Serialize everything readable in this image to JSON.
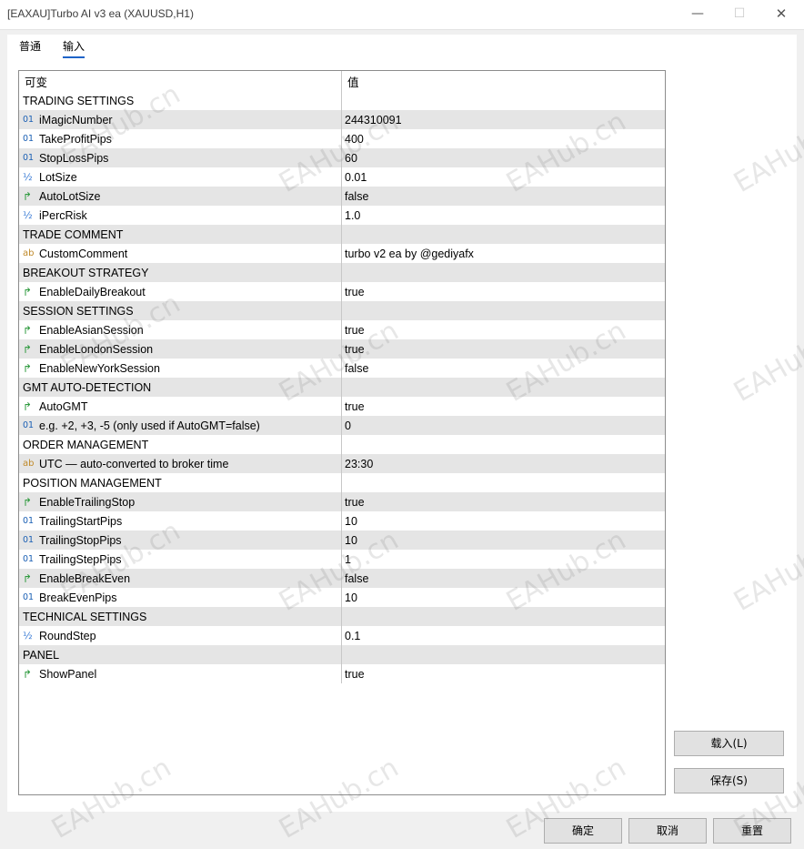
{
  "window": {
    "title": "[EAXAU]Turbo AI v3 ea (XAUUSD,H1)",
    "minimize": "—",
    "maximize": "☐",
    "close": "✕"
  },
  "tabs": [
    {
      "label": "普通"
    },
    {
      "label": "输入"
    }
  ],
  "grid": {
    "headers": {
      "variable": "可变",
      "value": "值"
    },
    "rows": [
      {
        "type": "section",
        "name": "TRADING SETTINGS",
        "value": ""
      },
      {
        "type": "int",
        "name": "iMagicNumber",
        "value": "244310091"
      },
      {
        "type": "int",
        "name": "TakeProfitPips",
        "value": "400"
      },
      {
        "type": "int",
        "name": "StopLossPips",
        "value": "60"
      },
      {
        "type": "double",
        "name": "LotSize",
        "value": "0.01"
      },
      {
        "type": "bool",
        "name": "AutoLotSize",
        "value": "false"
      },
      {
        "type": "double",
        "name": "iPercRisk",
        "value": "1.0"
      },
      {
        "type": "section",
        "name": "TRADE COMMENT",
        "value": ""
      },
      {
        "type": "string",
        "name": "CustomComment",
        "value": "turbo v2 ea by @gediyafx"
      },
      {
        "type": "section",
        "name": "BREAKOUT STRATEGY",
        "value": ""
      },
      {
        "type": "bool",
        "name": "EnableDailyBreakout",
        "value": "true"
      },
      {
        "type": "section",
        "name": "SESSION SETTINGS",
        "value": ""
      },
      {
        "type": "bool",
        "name": "EnableAsianSession",
        "value": "true"
      },
      {
        "type": "bool",
        "name": "EnableLondonSession",
        "value": "true"
      },
      {
        "type": "bool",
        "name": "EnableNewYorkSession",
        "value": "false"
      },
      {
        "type": "section",
        "name": "GMT AUTO-DETECTION",
        "value": ""
      },
      {
        "type": "bool",
        "name": "AutoGMT",
        "value": "true"
      },
      {
        "type": "int",
        "name": "e.g. +2, +3, -5 (only used if AutoGMT=false)",
        "value": "0"
      },
      {
        "type": "section",
        "name": "ORDER MANAGEMENT",
        "value": ""
      },
      {
        "type": "string",
        "name": "UTC — auto-converted to broker time",
        "value": "23:30"
      },
      {
        "type": "section",
        "name": "POSITION MANAGEMENT",
        "value": ""
      },
      {
        "type": "bool",
        "name": "EnableTrailingStop",
        "value": "true"
      },
      {
        "type": "int",
        "name": "TrailingStartPips",
        "value": "10"
      },
      {
        "type": "int",
        "name": "TrailingStopPips",
        "value": "10"
      },
      {
        "type": "int",
        "name": "TrailingStepPips",
        "value": "1"
      },
      {
        "type": "bool",
        "name": "EnableBreakEven",
        "value": "false"
      },
      {
        "type": "int",
        "name": "BreakEvenPips",
        "value": "10"
      },
      {
        "type": "section",
        "name": "TECHNICAL SETTINGS",
        "value": ""
      },
      {
        "type": "double",
        "name": "RoundStep",
        "value": "0.1"
      },
      {
        "type": "section",
        "name": "PANEL",
        "value": ""
      },
      {
        "type": "bool",
        "name": "ShowPanel",
        "value": "true"
      }
    ]
  },
  "icons": {
    "int": {
      "glyph": "01",
      "name": "integer-type-icon"
    },
    "double": {
      "glyph": "½",
      "name": "double-type-icon"
    },
    "bool": {
      "glyph": "↱",
      "name": "boolean-type-icon"
    },
    "string": {
      "glyph": "ab",
      "name": "string-type-icon"
    }
  },
  "buttons": {
    "load": "载入(L)",
    "save": "保存(S)",
    "ok": "确定",
    "cancel": "取消",
    "reset": "重置"
  },
  "watermark": "EAHub.cn"
}
